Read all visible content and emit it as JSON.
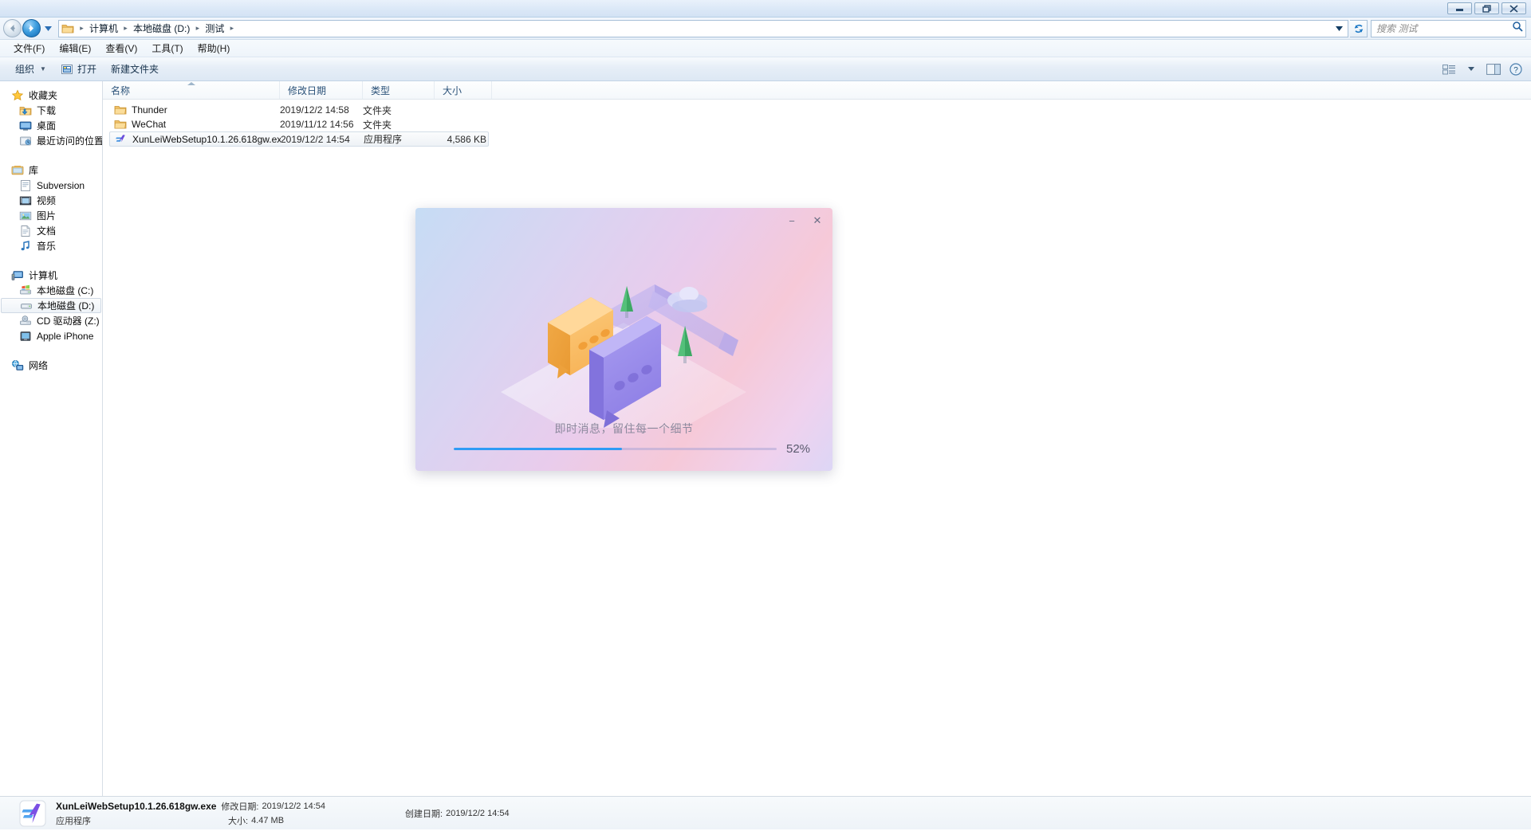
{
  "titlebar": {
    "buttons": [
      {
        "name": "minimize-button",
        "glyph": "minimize"
      },
      {
        "name": "restore-button",
        "glyph": "restore"
      },
      {
        "name": "close-button",
        "glyph": "close"
      }
    ]
  },
  "address": {
    "breadcrumbs": [
      "计算机",
      "本地磁盘 (D:)",
      "测试"
    ],
    "separator": "▸",
    "back_tooltip": "后退",
    "forward_tooltip": "前进"
  },
  "search": {
    "placeholder": "搜索 测试",
    "icon": "search-icon"
  },
  "menu": {
    "items": [
      "文件(F)",
      "编辑(E)",
      "查看(V)",
      "工具(T)",
      "帮助(H)"
    ]
  },
  "toolbar": {
    "organize": "组织",
    "open": "打开",
    "new_folder": "新建文件夹",
    "caret": "▼",
    "right_icons": [
      "view-mode-icon",
      "view-dropdown-icon",
      "preview-pane-icon",
      "help-icon"
    ]
  },
  "sidebar": {
    "groups": [
      {
        "name": "favorites",
        "head": {
          "label": "收藏夹",
          "icon": "star-icon"
        },
        "items": [
          {
            "label": "下载",
            "icon": "downloads-icon",
            "selected": false
          },
          {
            "label": "桌面",
            "icon": "desktop-icon",
            "selected": false
          },
          {
            "label": "最近访问的位置",
            "icon": "recent-places-icon",
            "selected": false
          }
        ]
      },
      {
        "name": "libraries",
        "head": {
          "label": "库",
          "icon": "library-icon"
        },
        "items": [
          {
            "label": "Subversion",
            "icon": "subversion-icon",
            "selected": false
          },
          {
            "label": "视频",
            "icon": "videos-icon",
            "selected": false
          },
          {
            "label": "图片",
            "icon": "pictures-icon",
            "selected": false
          },
          {
            "label": "文档",
            "icon": "documents-icon",
            "selected": false
          },
          {
            "label": "音乐",
            "icon": "music-icon",
            "selected": false
          }
        ]
      },
      {
        "name": "computer",
        "head": {
          "label": "计算机",
          "icon": "computer-icon"
        },
        "items": [
          {
            "label": "本地磁盘 (C:)",
            "icon": "windows-drive-icon",
            "selected": false
          },
          {
            "label": "本地磁盘 (D:)",
            "icon": "drive-icon",
            "selected": true
          },
          {
            "label": "CD 驱动器 (Z:)",
            "icon": "cd-drive-icon",
            "selected": false
          },
          {
            "label": "Apple iPhone",
            "icon": "portable-device-icon",
            "selected": false
          }
        ]
      },
      {
        "name": "network",
        "head": {
          "label": "网络",
          "icon": "network-icon"
        },
        "items": []
      }
    ]
  },
  "filelist": {
    "columns": [
      {
        "label": "名称",
        "key": "name",
        "sorted": true
      },
      {
        "label": "修改日期",
        "key": "date",
        "sorted": false
      },
      {
        "label": "类型",
        "key": "type",
        "sorted": false
      },
      {
        "label": "大小",
        "key": "size",
        "sorted": false
      }
    ],
    "rows": [
      {
        "name": "Thunder",
        "date": "2019/12/2 14:58",
        "type": "文件夹",
        "size": "",
        "icon": "folder-icon",
        "selected": false
      },
      {
        "name": "WeChat",
        "date": "2019/11/12 14:56",
        "type": "文件夹",
        "size": "",
        "icon": "folder-icon",
        "selected": false
      },
      {
        "name": "XunLeiWebSetup10.1.26.618gw.exe",
        "date": "2019/12/2 14:54",
        "type": "应用程序",
        "size": "4,586 KB",
        "icon": "xunlei-icon",
        "selected": true
      }
    ]
  },
  "statusbar": {
    "icon": "xunlei-icon",
    "file_name": "XunLeiWebSetup10.1.26.618gw.exe",
    "file_type": "应用程序",
    "modified_label": "修改日期:",
    "modified_value": "2019/12/2 14:54",
    "size_label": "大小:",
    "size_value": "4.47 MB",
    "created_label": "创建日期:",
    "created_value": "2019/12/2 14:54"
  },
  "installer": {
    "minimize_glyph": "−",
    "close_glyph": "✕",
    "tagline": "即时消息，留住每一个细节",
    "progress_percent": 52,
    "progress_label": "52%",
    "accent_color": "#2f9bf5"
  }
}
